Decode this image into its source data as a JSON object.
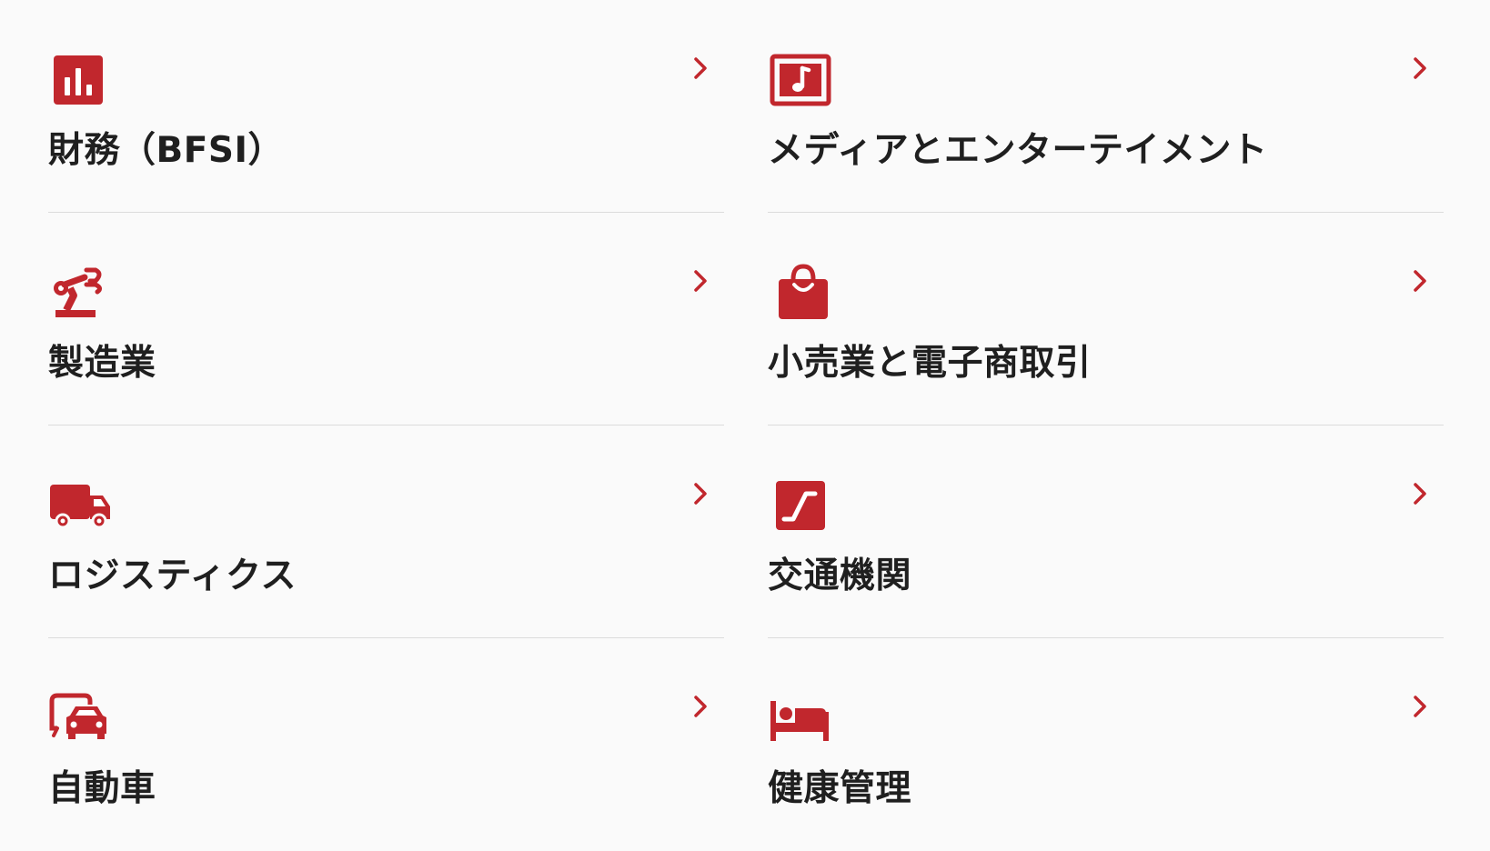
{
  "accent_color": "#c1272d",
  "industries": [
    {
      "label": "財務（BFSI）",
      "icon": "bar-chart-icon"
    },
    {
      "label": "メディアとエンターテイメント",
      "icon": "music-note-icon"
    },
    {
      "label": "製造業",
      "icon": "robot-arm-icon"
    },
    {
      "label": "小売業と電子商取引",
      "icon": "shopping-bag-icon"
    },
    {
      "label": "ロジスティクス",
      "icon": "truck-icon"
    },
    {
      "label": "交通機関",
      "icon": "escalator-icon"
    },
    {
      "label": "自動車",
      "icon": "car-icon"
    },
    {
      "label": "健康管理",
      "icon": "bed-icon"
    }
  ]
}
